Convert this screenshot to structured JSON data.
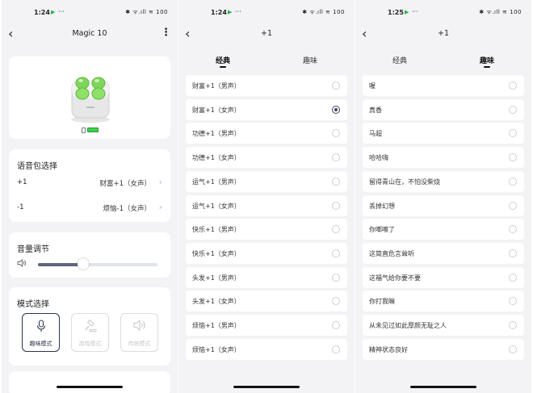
{
  "colors": {
    "page_bg": "#f3f3f5",
    "card_bg": "#ffffff",
    "accent": "#3b4663",
    "device_green": "#7fd65a",
    "battery_green": "#3ccf4e"
  },
  "screen1": {
    "status": {
      "time": "1:24",
      "icons": "✱ ᯤ.ıll ≋ 100"
    },
    "title": "Magic 10",
    "voice_section": {
      "title": "语音包选择",
      "rows": [
        {
          "key": "+1",
          "value": "财富+1（女声）"
        },
        {
          "key": "-1",
          "value": "烦恼-1（女声）"
        }
      ]
    },
    "volume_section": {
      "title": "音量调节",
      "level": 0.38
    },
    "mode_section": {
      "title": "模式选择",
      "modes": [
        {
          "label": "趣味模式",
          "icon": "microphone-icon",
          "active": true
        },
        {
          "label": "游戏模式",
          "icon": "gavel-icon",
          "active": false
        },
        {
          "label": "传统模式",
          "icon": "speaker-icon",
          "active": false
        }
      ]
    }
  },
  "screen2": {
    "status": {
      "time": "1:24",
      "icons": "✱ ᯤ.ıll ≋ 100"
    },
    "title": "+1",
    "tabs": [
      "经典",
      "趣味"
    ],
    "active_tab": 0,
    "selected_index": 1,
    "items": [
      "财富+1（男声）",
      "财富+1（女声）",
      "功德+1（男声）",
      "功德+1（女声）",
      "运气+1（男声）",
      "运气+1（女声）",
      "快乐+1（男声）",
      "快乐+1（女声）",
      "头发+1（男声）",
      "头发+1（女声）",
      "烦恼+1（男声）",
      "烦恼+1（女声）"
    ]
  },
  "screen3": {
    "status": {
      "time": "1:25",
      "icons": "✱ ᯤ.ıll ≋ 100"
    },
    "title": "+1",
    "tabs": [
      "经典",
      "趣味"
    ],
    "active_tab": 1,
    "selected_index": -1,
    "items": [
      "喔",
      "真香",
      "马超",
      "哈哈嗨",
      "留得青山在，不怕没柴烧",
      "丢掉幻想",
      "你啷嚓了",
      "这简直危言耸听",
      "这福气给你要不要",
      "你打我嘛",
      "从未见过如此厚颜无耻之人",
      "精神状态良好"
    ]
  }
}
